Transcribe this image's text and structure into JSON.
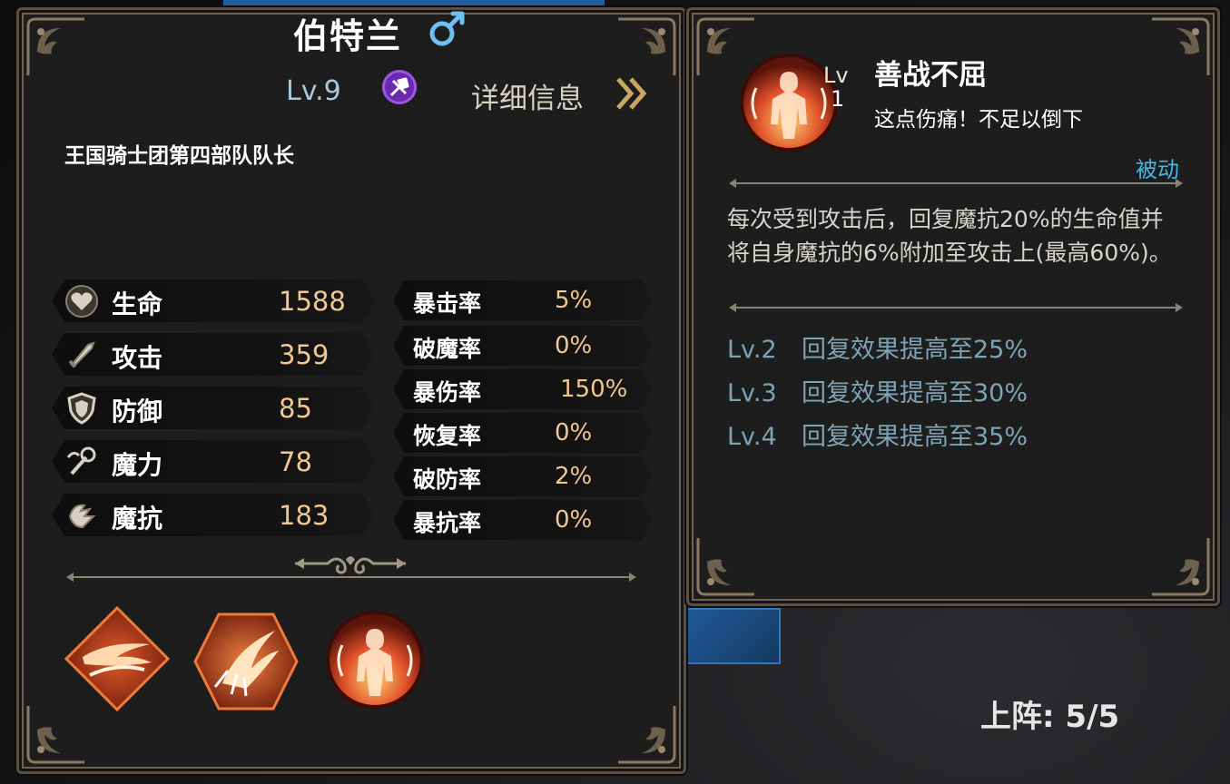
{
  "character": {
    "name": "伯特兰",
    "gender_icon": "male-symbol-icon",
    "level": "Lv.9",
    "class_icon": "class-emblem-icon",
    "detail_link": "详细信息",
    "title": "王国骑士团第四部队队长"
  },
  "stats": [
    {
      "icon": "heart-icon",
      "label": "生命",
      "value": "1588"
    },
    {
      "icon": "sword-icon",
      "label": "攻击",
      "value": "359"
    },
    {
      "icon": "shield-icon",
      "label": "防御",
      "value": "85"
    },
    {
      "icon": "magic-staff-icon",
      "label": "魔力",
      "value": "78"
    },
    {
      "icon": "magic-resist-icon",
      "label": "魔抗",
      "value": "183"
    }
  ],
  "sub_stats": [
    {
      "label": "暴击率",
      "value": "5%"
    },
    {
      "label": "破魔率",
      "value": "0%"
    },
    {
      "label": "暴伤率",
      "value": "150%"
    },
    {
      "label": "恢复率",
      "value": "0%"
    },
    {
      "label": "破防率",
      "value": "2%"
    },
    {
      "label": "暴抗率",
      "value": "0%"
    }
  ],
  "skills": [
    {
      "icon": "slash-skill-icon",
      "shape": "diamond"
    },
    {
      "icon": "burst-skill-icon",
      "shape": "hexagon"
    },
    {
      "icon": "endure-skill-icon",
      "shape": "circle"
    }
  ],
  "skill_detail": {
    "lv_label": "Lv",
    "lv_value": "1",
    "name": "善战不屈",
    "quote": "这点伤痛！不足以倒下",
    "type": "被动",
    "description": "每次受到攻击后，回复魔抗20%的生命值并将自身魔抗的6%附加至攻击上(最高60%)。",
    "upgrades": [
      {
        "level": "Lv.2",
        "text": "回复效果提高至25%"
      },
      {
        "level": "Lv.3",
        "text": "回复效果提高至30%"
      },
      {
        "level": "Lv.4",
        "text": "回复效果提高至35%"
      }
    ]
  },
  "deploy": {
    "text": "上阵: 5/5"
  },
  "colors": {
    "stat_value": "#f0c890",
    "passive_tag": "#42b8e8",
    "upgrade_text": "#7ea4b4",
    "level_text": "#a8c8dc"
  }
}
